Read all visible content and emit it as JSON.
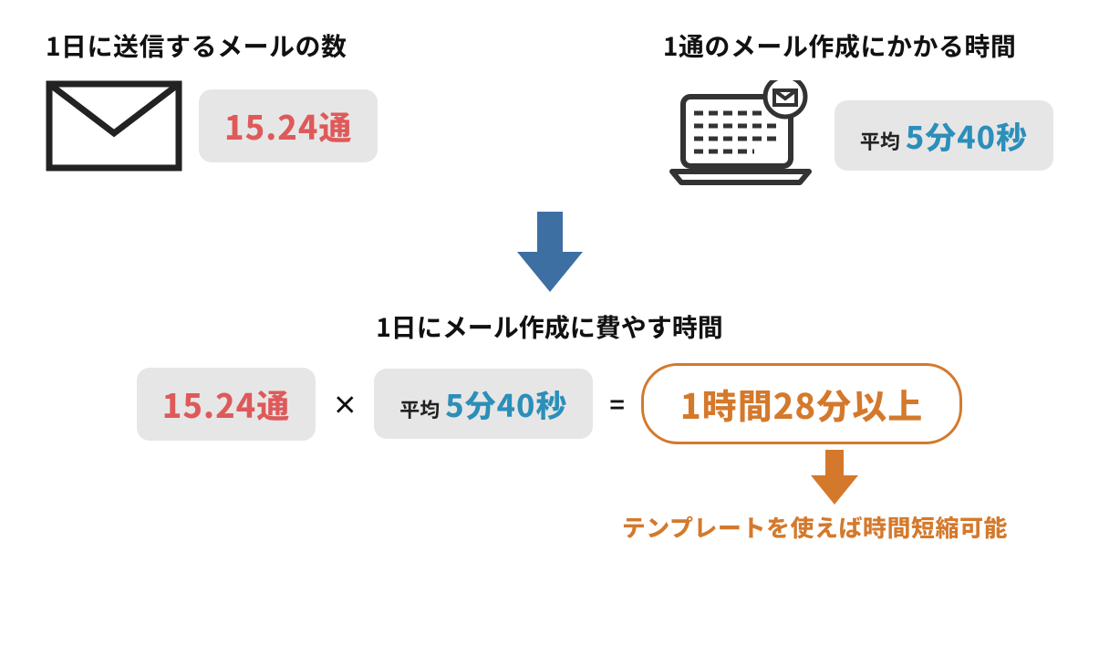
{
  "top": {
    "left": {
      "heading": "1日に送信するメールの数",
      "emailCount": "15.24通"
    },
    "right": {
      "heading": "1通のメール作成にかかる時間",
      "avgPrefix": "平均",
      "avgTime": "5分40秒"
    }
  },
  "middle": {
    "heading": "1日にメール作成に費やす時間",
    "countPill": "15.24通",
    "opMultiply": "×",
    "avgPrefix": "平均",
    "avgTime": "5分40秒",
    "opEquals": "=",
    "result": "1時間28分以上"
  },
  "bottom": {
    "caption": "テンプレートを使えば時間短縮可能"
  },
  "colors": {
    "red": "#de5a5a",
    "blue": "#2b8fba",
    "orange": "#d4792c",
    "arrowBlue": "#3d6fa3",
    "pillBg": "#e7e6e6"
  }
}
